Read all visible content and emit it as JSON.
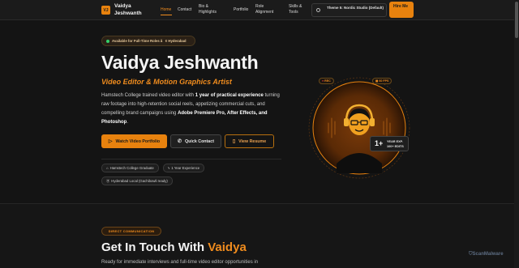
{
  "nav": {
    "logo_initials": "VJ",
    "brand": "Vaidya Jeshwanth",
    "links": [
      "Home",
      "Contact",
      "Bio & Highlights",
      "Portfolio",
      "Role Alignment",
      "Skills & Tools"
    ],
    "theme_label": "Theme 5: Nordic Studio (Default)",
    "hire_label": "Hire Me"
  },
  "hero": {
    "availability": "Available for Full-Time Roles â¢ Hyderabad",
    "name": "Vaidya Jeshwanth",
    "role": "Video Editor & Motion Graphics Artist",
    "desc_1": "Hamstech College trained video editor with ",
    "desc_bold_1": "1 year of practical experience",
    "desc_2": " turning raw footage into high-retention social reels, appetizing commercial cuts, and compelling brand campaigns using ",
    "desc_bold_2": "Adobe Premiere Pro, After Effects, and Photoshop",
    "desc_3": ".",
    "btn_portfolio": "Watch Video Portfolio",
    "btn_contact": "Quick Contact",
    "btn_resume": "View Resume",
    "chips": [
      "Hamstech College Graduate",
      "1 Year Experience",
      "Hyderabad Local (Gachibowli ready)"
    ]
  },
  "avatar": {
    "badge_rec": "REC",
    "badge_fps": "60 FPS",
    "exp_value": "1+",
    "exp_line1": "YEAR EXP.",
    "exp_line2": "100+ EDITS"
  },
  "contact": {
    "pill": "DIRECT COMMUNICATION",
    "title_plain": "Get In Touch With ",
    "title_highlight": "Vaidya",
    "subtitle": "Ready for immediate interviews and full-time video editor opportunities in"
  },
  "watermark": "ScanMalware",
  "colors": {
    "accent": "#e8820e",
    "background": "#141414",
    "online": "#35d06a"
  }
}
